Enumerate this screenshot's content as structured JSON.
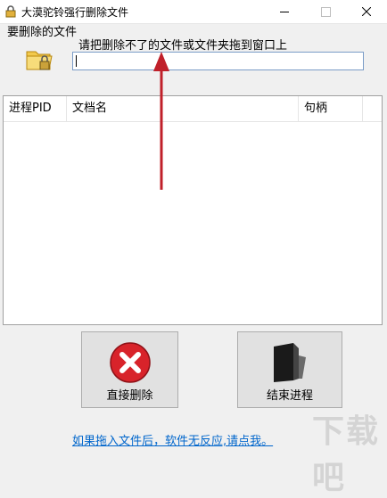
{
  "window": {
    "title": "大漠驼铃强行删除文件",
    "app_icon": "lock-icon",
    "minimize_icon": "minimize-icon",
    "maximize_icon": "maximize-icon",
    "close_icon": "close-icon"
  },
  "drop_area": {
    "label": "要删除的文件",
    "hint": "请把删除不了的文件或文件夹拖到窗口上",
    "path_value": "",
    "icon": "folder-lock-icon"
  },
  "table": {
    "columns": [
      "进程PID",
      "文档名",
      "句柄"
    ],
    "rows": []
  },
  "buttons": {
    "delete_label": "直接删除",
    "delete_icon": "red-x-icon",
    "kill_label": "结束进程",
    "kill_icon": "black-folder-icon"
  },
  "footer": {
    "link_text": "如果拖入文件后，软件无反应,请点我。"
  },
  "colors": {
    "accent_link": "#0066cc",
    "arrow": "#c0202a",
    "delete_red": "#d8232a"
  },
  "watermark": "下载吧"
}
